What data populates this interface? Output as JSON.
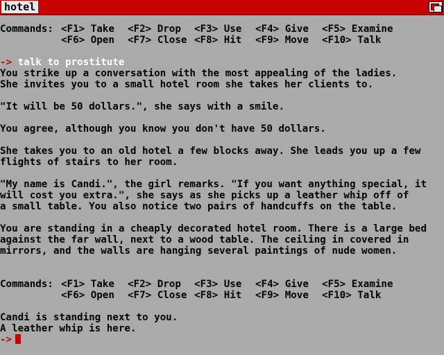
{
  "window": {
    "title": "hotel"
  },
  "commands_label": "Commands:",
  "commands_row1": [
    "<F1> Take",
    "<F2> Drop",
    "<F3> Use",
    "<F4> Give",
    "<F5> Examine"
  ],
  "commands_row2": [
    "<F6> Open",
    "<F7> Close",
    "<F8> Hit",
    "<F9> Move",
    "<F10> Talk"
  ],
  "prompt_symbol": "->",
  "last_command": "talk to prostitute",
  "story": [
    "You strike up a conversation with the most appealing of the ladies.",
    "She invites you to a small hotel room she takes her clients to.",
    "",
    "\"It will be 50 dollars.\", she says with a smile.",
    "",
    "You agree, although you know you don't have 50 dollars.",
    "",
    "She takes you to an old hotel a few blocks away. She leads you up a few",
    "flights of stairs to her room.",
    "",
    "\"My name is Candi.\", the girl remarks. \"If you want anything special, it",
    "will cost you extra.\", she says as she picks up a leather whip off of",
    "a small table. You also notice two pairs of handcuffs on the table.",
    "",
    "You are standing in a cheaply decorated hotel room. There is a large bed",
    "against the far wall, next to a wood table. The ceiling in covered in",
    "mirrors, and the walls are hanging several paintings of nude women."
  ],
  "status": [
    "Candi is standing next to you.",
    "A leather whip is here."
  ],
  "colors": {
    "background": "#aaaaaa",
    "titlebar": "#c80000",
    "prompt": "#c80000",
    "input": "#ffffff",
    "text": "#000000"
  }
}
